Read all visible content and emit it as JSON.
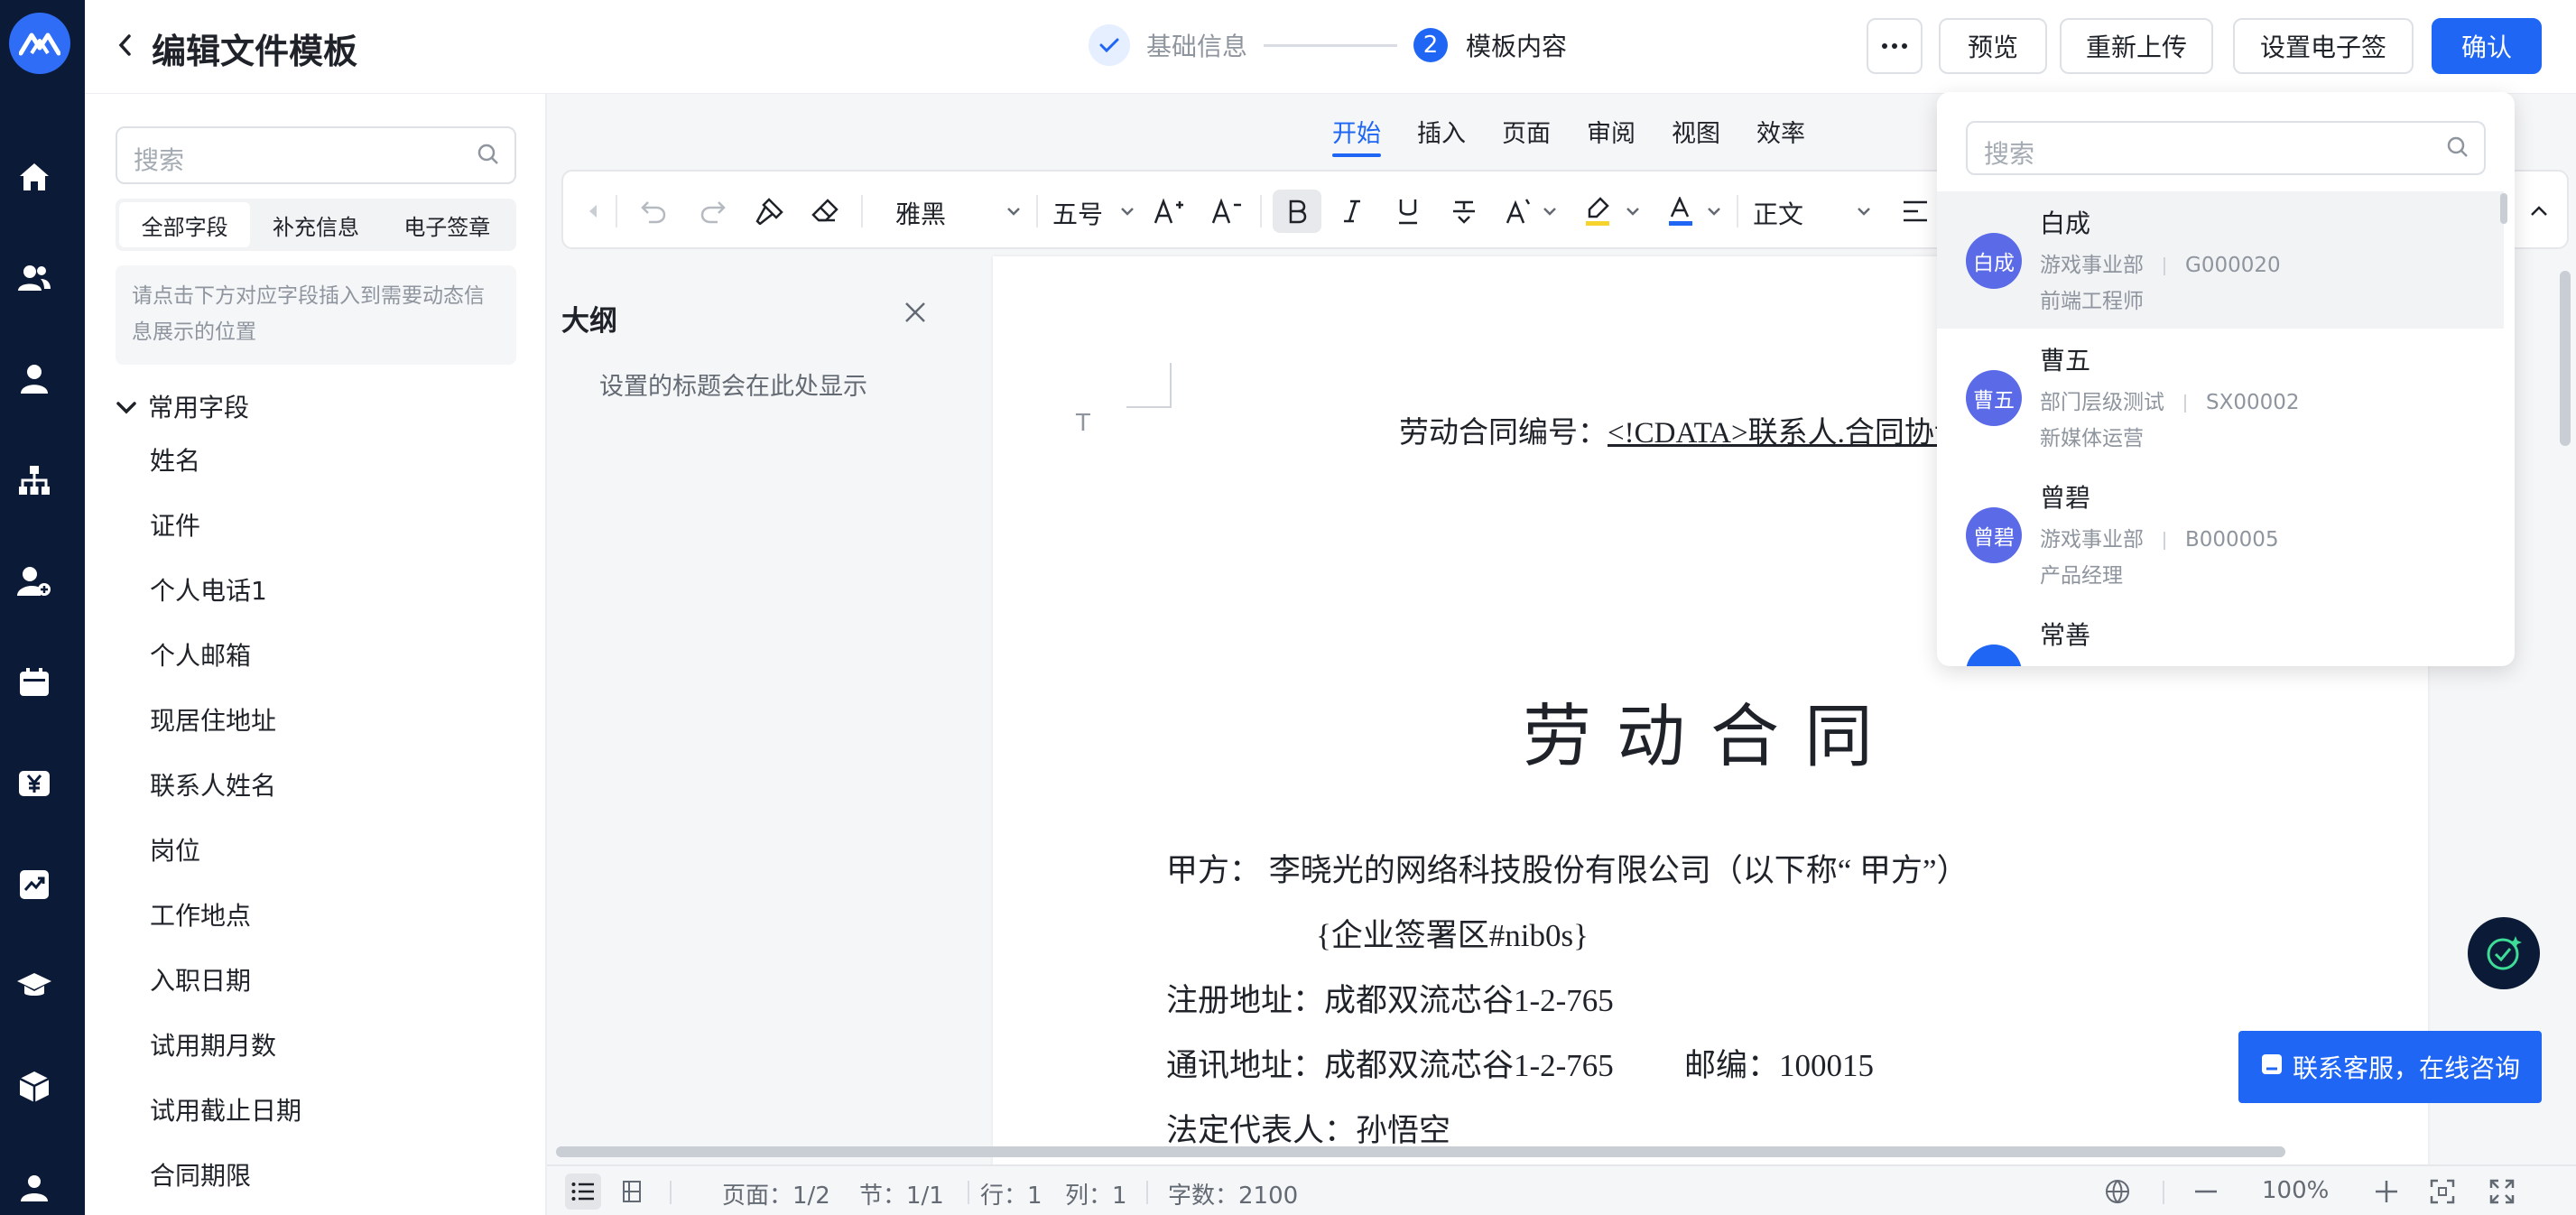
{
  "header": {
    "back_label": "‹",
    "title": "编辑文件模板",
    "steps": [
      {
        "label": "基础信息",
        "state": "done"
      },
      {
        "number": "2",
        "label": "模板内容",
        "state": "active"
      }
    ],
    "more_label": "···",
    "buttons": {
      "preview": "预览",
      "reupload": "重新上传",
      "esign": "设置电子签",
      "confirm": "确认"
    }
  },
  "rail": {
    "icons": [
      "logo-icon",
      "home-icon",
      "team-icon",
      "user-icon",
      "org-chart-icon",
      "add-user-icon",
      "calendar-icon",
      "payroll-icon",
      "report-icon",
      "training-icon",
      "package-icon",
      "profile-icon"
    ]
  },
  "field_panel": {
    "search_placeholder": "搜索",
    "tabs": [
      "全部字段",
      "补充信息",
      "电子签章"
    ],
    "active_tab": 0,
    "hint": "请点击下方对应字段插入到需要动态信息展示的位置",
    "group_label": "常用字段",
    "fields": [
      "姓名",
      "证件",
      "个人电话1",
      "个人邮箱",
      "现居住地址",
      "联系人姓名",
      "岗位",
      "工作地点",
      "入职日期",
      "试用期月数",
      "试用截止日期",
      "合同期限"
    ]
  },
  "editor": {
    "tabs": [
      "开始",
      "插入",
      "页面",
      "审阅",
      "视图",
      "效率"
    ],
    "active_tab": 0,
    "toolbar": {
      "font_family": "雅黑",
      "font_size": "五号",
      "paragraph_style": "正文"
    },
    "outline": {
      "title": "大纲",
      "hint": "设置的标题会在此处显示"
    },
    "document": {
      "contract_no_label": "劳动合同编号：",
      "contract_no_value": "<!CDATA>联系人.合同协议",
      "heading": "劳动合同",
      "party_a": "甲方：  李晓光的网络科技股份有限公司（以下称“ 甲方”）",
      "seal": "{企业签署区#nib0s}",
      "reg_address": "注册地址：成都双流芯谷1-2-765",
      "mail_address": "通讯地址：成都双流芯谷1-2-765",
      "postcode": "邮编：100015",
      "legal_rep": "法定代表人：孙悟空"
    },
    "status": {
      "page": "页面：1/2",
      "section": "节：1/1",
      "row": "行：1",
      "col": "列：1",
      "words": "字数：2100",
      "zoom": "100%"
    }
  },
  "person_dropdown": {
    "search_placeholder": "搜索",
    "people": [
      {
        "avatar": "白成",
        "name": "白成",
        "dept": "游戏事业部",
        "id": "G000020",
        "role": "前端工程师"
      },
      {
        "avatar": "曹五",
        "name": "曹五",
        "dept": "部门层级测试",
        "id": "SX00002",
        "role": "新媒体运营"
      },
      {
        "avatar": "曾碧",
        "name": "曾碧",
        "dept": "游戏事业部",
        "id": "B000005",
        "role": "产品经理"
      },
      {
        "avatar": "",
        "name": "常善",
        "dept": "",
        "id": "",
        "role": ""
      }
    ]
  },
  "support": {
    "label": "联系客服，在线咨询"
  },
  "colors": {
    "primary": "#1f66f5",
    "rail": "#0b1a36",
    "avatar": "#5b6be8"
  }
}
